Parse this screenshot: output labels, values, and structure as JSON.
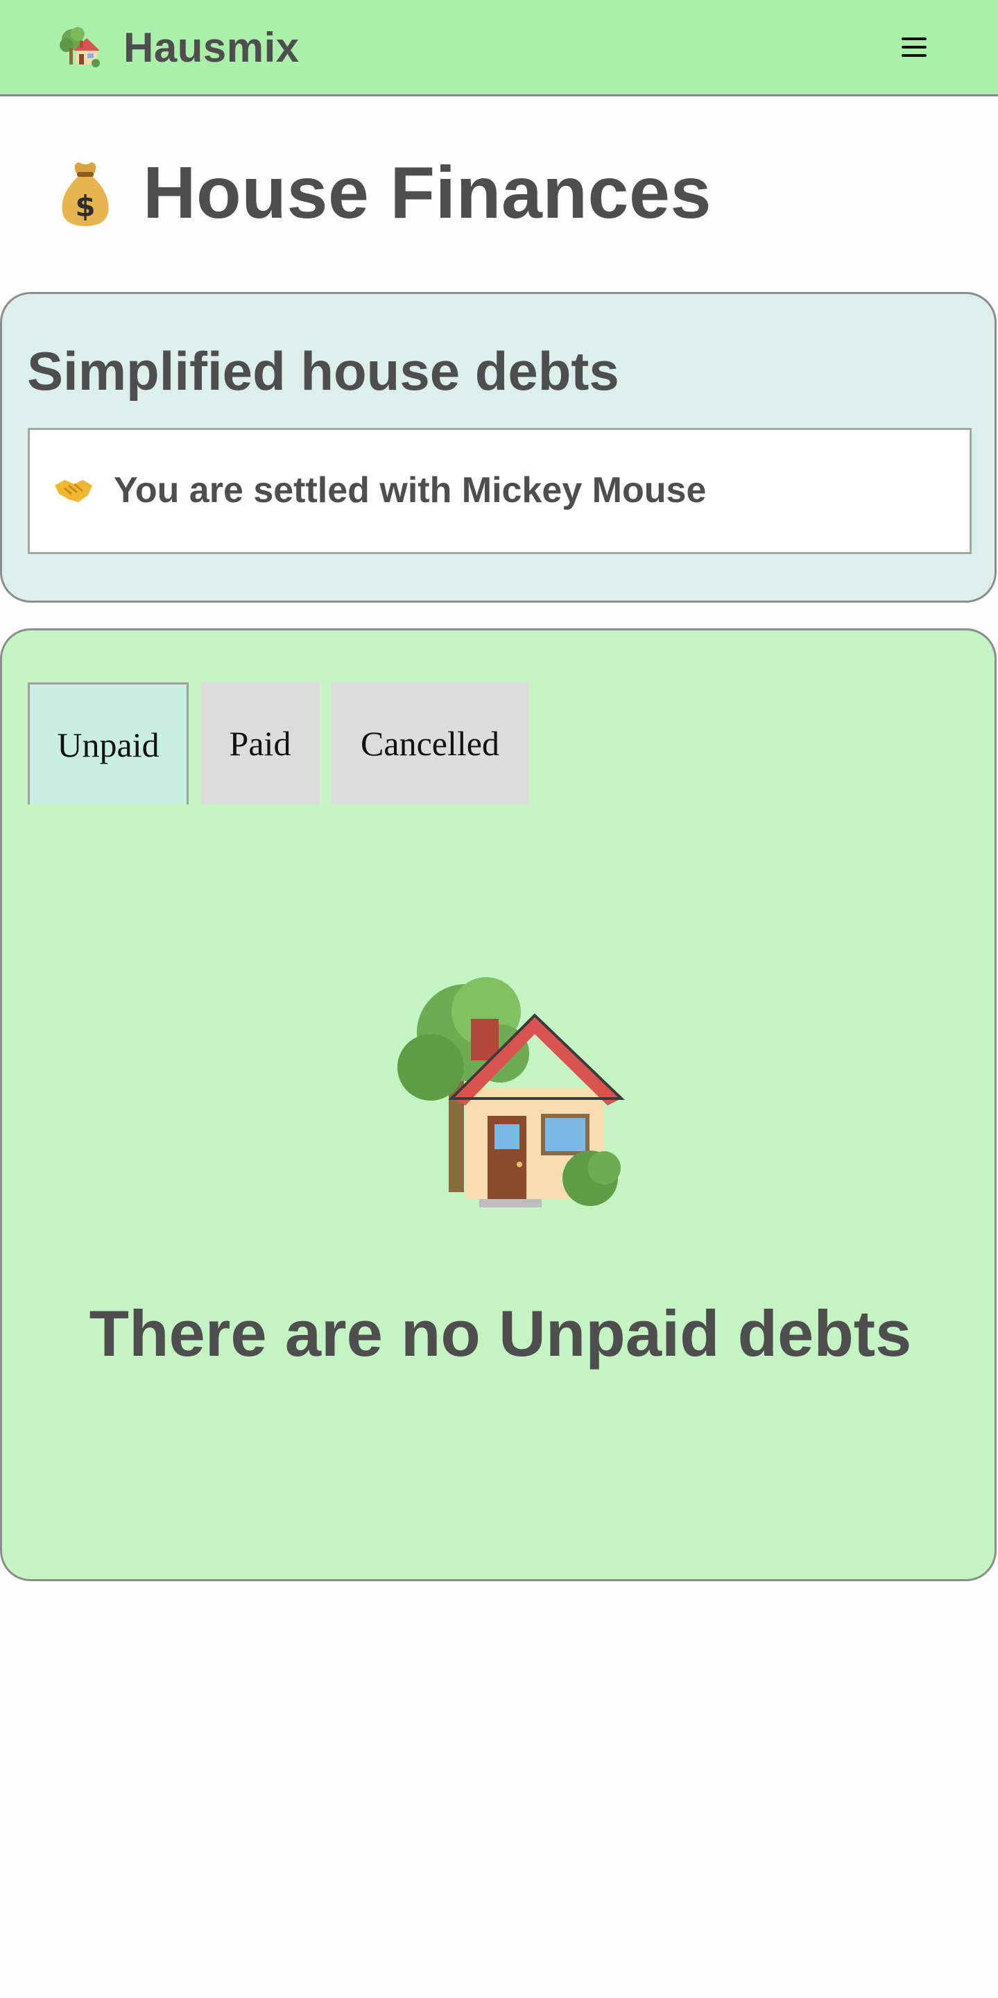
{
  "navbar": {
    "app_name": "Hausmix",
    "logo_icon": "house-with-garden-icon",
    "menu_icon": "hamburger-menu-icon",
    "background_color": "#aaf0aa"
  },
  "page": {
    "title": "House Finances",
    "title_icon": "money-bag-icon"
  },
  "simplified_debts": {
    "heading": "Simplified house debts",
    "items": [
      {
        "icon": "handshake-icon",
        "text": "You are settled with Mickey Mouse"
      }
    ],
    "background_color": "#dcefec"
  },
  "debts_list": {
    "tabs": [
      {
        "label": "Unpaid",
        "active": true
      },
      {
        "label": "Paid",
        "active": false
      },
      {
        "label": "Cancelled",
        "active": false
      }
    ],
    "empty_state": {
      "icon": "house-with-garden-icon",
      "message": "There are no Unpaid debts"
    },
    "background_color": "#c4f3c4",
    "active_tab_color": "#c9efe2"
  }
}
